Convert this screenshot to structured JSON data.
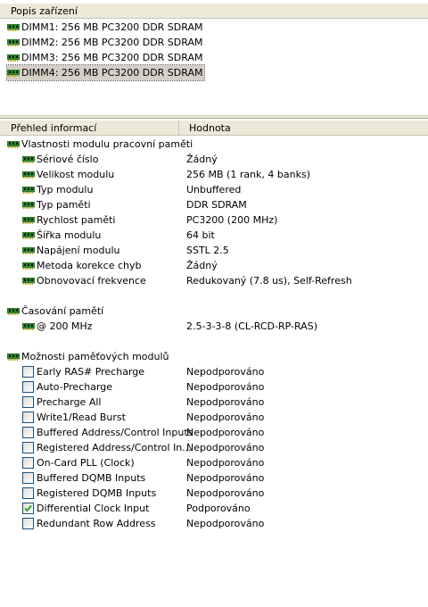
{
  "device_pane": {
    "header": "Popis zařízení",
    "items": [
      {
        "label": "DIMM1: 256 MB PC3200 DDR SDRAM"
      },
      {
        "label": "DIMM2: 256 MB PC3200 DDR SDRAM"
      },
      {
        "label": "DIMM3: 256 MB PC3200 DDR SDRAM"
      },
      {
        "label": "DIMM4: 256 MB PC3200 DDR SDRAM",
        "selected": true
      }
    ]
  },
  "details": {
    "col_field": "Přehled informací",
    "col_value": "Hodnota",
    "groups": [
      {
        "title": "Vlastnosti modulu pracovní paměti",
        "rows": [
          {
            "label": "Sériové číslo",
            "value": "Žádný"
          },
          {
            "label": "Velikost modulu",
            "value": "256 MB (1 rank, 4 banks)"
          },
          {
            "label": "Typ modulu",
            "value": "Unbuffered"
          },
          {
            "label": "Typ paměti",
            "value": "DDR SDRAM"
          },
          {
            "label": "Rychlost paměti",
            "value": "PC3200 (200 MHz)"
          },
          {
            "label": "Šířka modulu",
            "value": "64 bit"
          },
          {
            "label": "Napájení modulu",
            "value": "SSTL 2.5"
          },
          {
            "label": "Metoda korekce chyb",
            "value": "Žádný"
          },
          {
            "label": "Obnovovací frekvence",
            "value": "Redukovaný (7.8 us), Self-Refresh"
          }
        ]
      },
      {
        "title": "Časování pamětí",
        "rows": [
          {
            "label": "@ 200 MHz",
            "value": "2.5-3-3-8  (CL-RCD-RP-RAS)"
          }
        ]
      },
      {
        "title": "Možnosti paměťových modulů",
        "rows": [
          {
            "label": "Early RAS# Precharge",
            "value": "Nepodporováno",
            "checked": false
          },
          {
            "label": "Auto-Precharge",
            "value": "Nepodporováno",
            "checked": false
          },
          {
            "label": "Precharge All",
            "value": "Nepodporováno",
            "checked": false
          },
          {
            "label": "Write1/Read Burst",
            "value": "Nepodporováno",
            "checked": false
          },
          {
            "label": "Buffered Address/Control Inputs",
            "value": "Nepodporováno",
            "checked": false
          },
          {
            "label": "Registered Address/Control In...",
            "value": "Nepodporováno",
            "checked": false
          },
          {
            "label": "On-Card PLL (Clock)",
            "value": "Nepodporováno",
            "checked": false
          },
          {
            "label": "Buffered DQMB Inputs",
            "value": "Nepodporováno",
            "checked": false
          },
          {
            "label": "Registered DQMB Inputs",
            "value": "Nepodporováno",
            "checked": false
          },
          {
            "label": "Differential Clock Input",
            "value": "Podporováno",
            "checked": true
          },
          {
            "label": "Redundant Row Address",
            "value": "Nepodporováno",
            "checked": false
          }
        ]
      }
    ]
  },
  "colors": {
    "ram_green": "#2f8a2f",
    "ram_dark": "#1a5c1a",
    "check_green": "#21a121"
  }
}
